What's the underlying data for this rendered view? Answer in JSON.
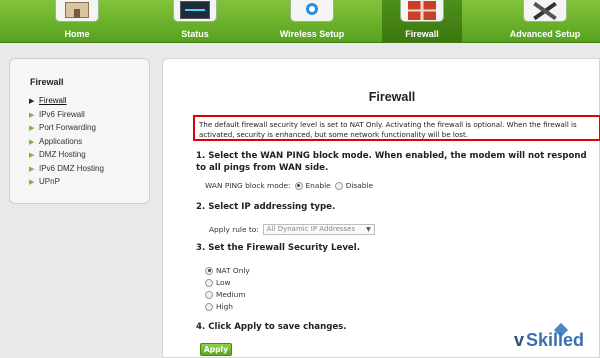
{
  "nav": {
    "tabs": [
      {
        "label": "Home",
        "icon": "home-icon"
      },
      {
        "label": "Status",
        "icon": "status-icon"
      },
      {
        "label": "Wireless Setup",
        "icon": "wireless-icon"
      },
      {
        "label": "Firewall",
        "icon": "firewall-icon",
        "active": true
      },
      {
        "label": "Advanced Setup",
        "icon": "tools-icon"
      }
    ]
  },
  "sidebar": {
    "title": "Firewall",
    "items": [
      {
        "label": "Firewall",
        "active": true
      },
      {
        "label": "IPv6 Firewall"
      },
      {
        "label": "Port Forwarding"
      },
      {
        "label": "Applications"
      },
      {
        "label": "DMZ Hosting"
      },
      {
        "label": "IPv6 DMZ Hosting"
      },
      {
        "label": "UPnP"
      }
    ]
  },
  "main": {
    "title": "Firewall",
    "note": "The default firewall security level is set to NAT Only. Activating the firewall is optional. When the firewall is activated, security is enhanced, but some network functionality will be lost.",
    "step1": "1. Select the WAN PING block mode. When enabled, the modem will not respond to all pings from WAN side.",
    "ping_label": "WAN PING block mode:",
    "ping_options": [
      "Enable",
      "Disable"
    ],
    "ping_selected": "Enable",
    "step2": "2. Select IP addressing type.",
    "apply_rule_label": "Apply rule to:",
    "apply_rule_value": "All Dynamic IP Addresses",
    "step3": "3. Set the Firewall Security Level.",
    "levels": [
      "NAT Only",
      "Low",
      "Medium",
      "High"
    ],
    "level_selected": "NAT Only",
    "step4": "4. Click Apply to save changes.",
    "apply_button": "Apply"
  },
  "watermark": {
    "v": "v",
    "text": "Skilled"
  },
  "colors": {
    "nav_green": "#6db52c",
    "highlight_red": "#e00000",
    "button_green": "#6fb92f"
  }
}
